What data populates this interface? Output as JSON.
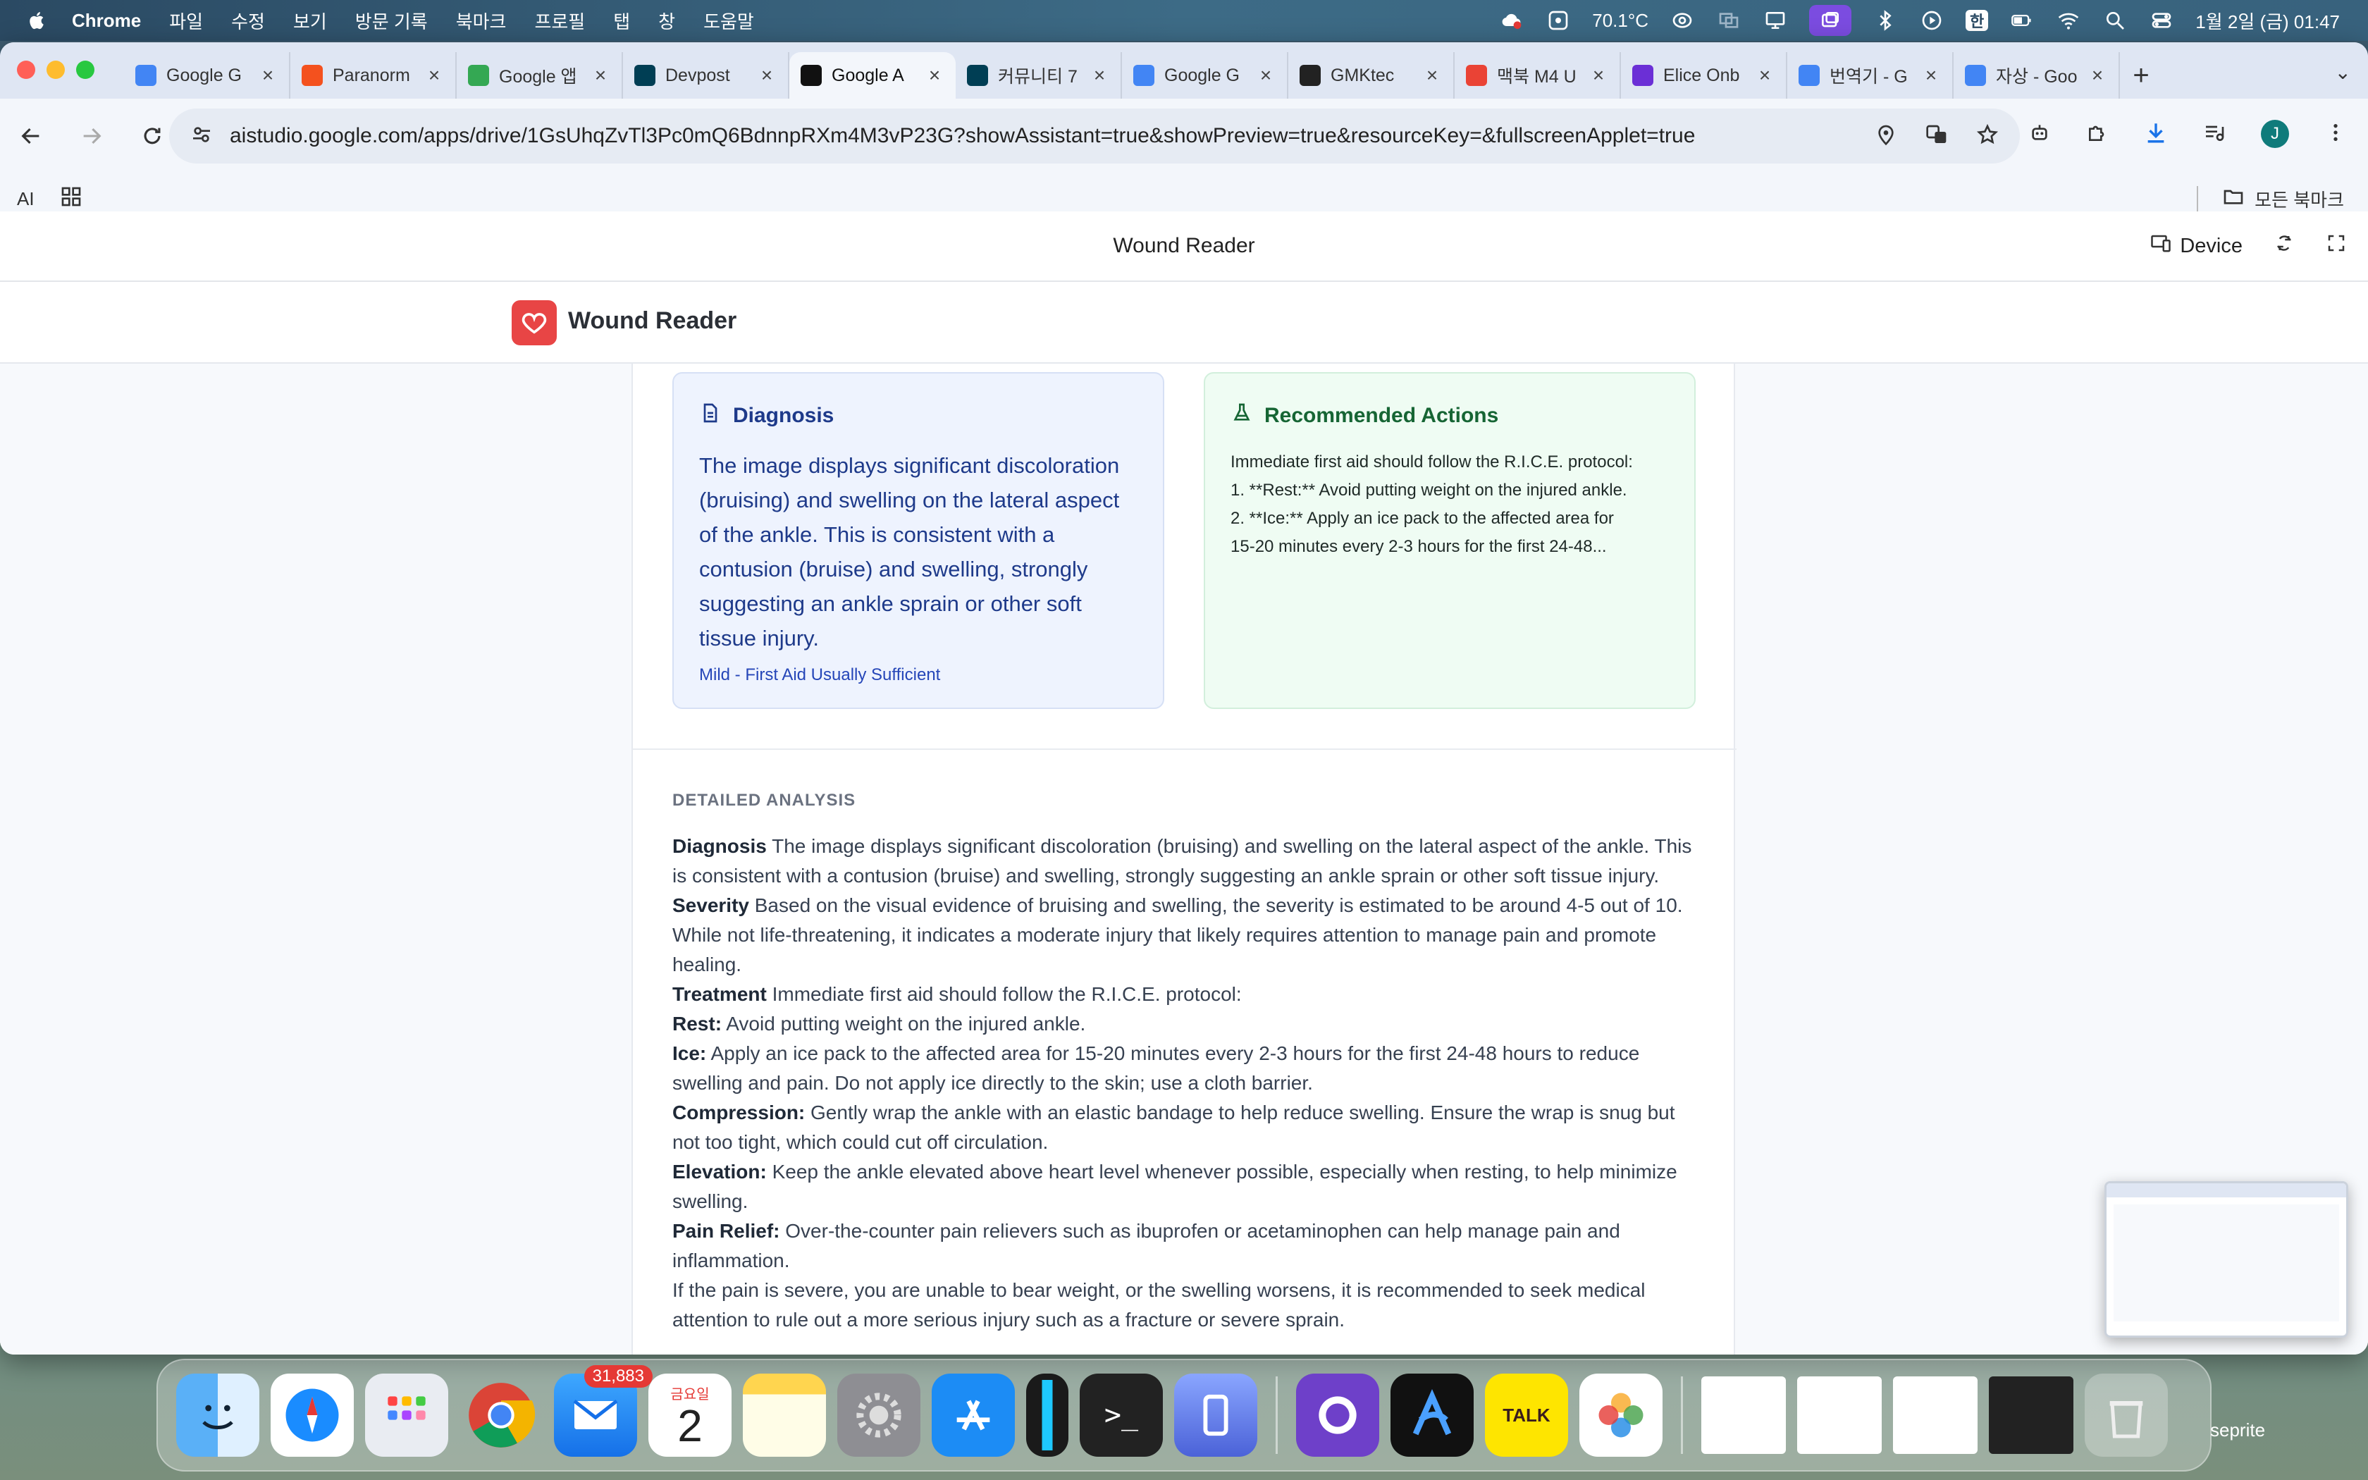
{
  "menubar": {
    "app_name": "Chrome",
    "items": [
      "파일",
      "수정",
      "보기",
      "방문 기록",
      "북마크",
      "프로필",
      "탭",
      "창",
      "도움말"
    ],
    "temperature": "70.1°C",
    "input_method": "한",
    "datetime": "1월 2일 (금) 01:47"
  },
  "browser": {
    "tabs": [
      {
        "label": "Google G",
        "fav_color": "#4285f4"
      },
      {
        "label": "Paranorm",
        "fav_color": "#f4511e"
      },
      {
        "label": "Google 앱",
        "fav_color": "#34a853"
      },
      {
        "label": "Devpost",
        "fav_color": "#003e54"
      },
      {
        "label": "Google A",
        "fav_color": "#111111"
      },
      {
        "label": "커뮤니티 7",
        "fav_color": "#003e54"
      },
      {
        "label": "Google G",
        "fav_color": "#4285f4"
      },
      {
        "label": "GMKtec",
        "fav_color": "#222222"
      },
      {
        "label": "맥북 M4 U",
        "fav_color": "#ea4335"
      },
      {
        "label": "Elice Onb",
        "fav_color": "#6b2fd6"
      },
      {
        "label": "번역기 - G",
        "fav_color": "#4285f4"
      },
      {
        "label": "자상 - Goo",
        "fav_color": "#4285f4"
      }
    ],
    "url": "aistudio.google.com/apps/drive/1GsUhqZvTl3Pc0mQ6BdnnpRXm4M3vP23G?showAssistant=true&showPreview=true&resourceKey=&fullscreenApplet=true",
    "profile_initial": "J",
    "bookmarks": {
      "left": "AI",
      "right": "모든 북마크"
    }
  },
  "applet": {
    "title": "Wound Reader",
    "device_label": "Device"
  },
  "app": {
    "brand": "Wound Reader",
    "diagnosis": {
      "heading": "Diagnosis",
      "text": "The image displays significant discoloration (bruising) and swelling on the lateral aspect of the ankle. This is consistent with a contusion (bruise) and swelling, strongly suggesting an ankle sprain or other soft tissue injury.",
      "severity": "Mild - First Aid Usually Sufficient"
    },
    "recommended": {
      "heading": "Recommended Actions",
      "lines": [
        "Immediate first aid should follow the R.I.C.E. protocol:",
        "1. **Rest:** Avoid putting weight on the injured ankle.",
        "2. **Ice:** Apply an ice pack to the affected area for",
        "15-20 minutes every 2-3 hours for the first 24-48..."
      ]
    },
    "analysis": {
      "title": "DETAILED ANALYSIS",
      "items": [
        {
          "label": "Diagnosis",
          "text": " The image displays significant discoloration (bruising) and swelling on the lateral aspect of the ankle. This is consistent with a contusion (bruise) and swelling, strongly suggesting an ankle sprain or other soft tissue injury."
        },
        {
          "label": "Severity",
          "text": " Based on the visual evidence of bruising and swelling, the severity is estimated to be around 4-5 out of 10. While not life-threatening, it indicates a moderate injury that likely requires attention to manage pain and promote healing."
        },
        {
          "label": "Treatment",
          "text": " Immediate first aid should follow the R.I.C.E. protocol:"
        },
        {
          "label": "Rest:",
          "text": " Avoid putting weight on the injured ankle."
        },
        {
          "label": "Ice:",
          "text": " Apply an ice pack to the affected area for 15-20 minutes every 2-3 hours for the first 24-48 hours to reduce swelling and pain. Do not apply ice directly to the skin; use a cloth barrier."
        },
        {
          "label": "Compression:",
          "text": " Gently wrap the ankle with an elastic bandage to help reduce swelling. Ensure the wrap is snug but not too tight, which could cut off circulation."
        },
        {
          "label": "Elevation:",
          "text": " Keep the ankle elevated above heart level whenever possible, especially when resting, to help minimize swelling."
        },
        {
          "label": "Pain Relief:",
          "text": " Over-the-counter pain relievers such as ibuprofen or acetaminophen can help manage pain and inflammation."
        },
        {
          "label": "",
          "text": "If the pain is severe, you are unable to bear weight, or the swelling worsens, it is recommended to seek medical attention to rule out a more serious injury such as a fracture or severe sprain."
        }
      ]
    }
  },
  "dock": {
    "mail_badge": "31,883",
    "calendar_day": "금요일",
    "calendar_date": "2",
    "kakao_label": "TALK",
    "desktop_label": "seprite"
  },
  "colors": {
    "logo_red": "#e84545",
    "diag_blue": "#1e3a8a",
    "rec_green": "#166534"
  }
}
